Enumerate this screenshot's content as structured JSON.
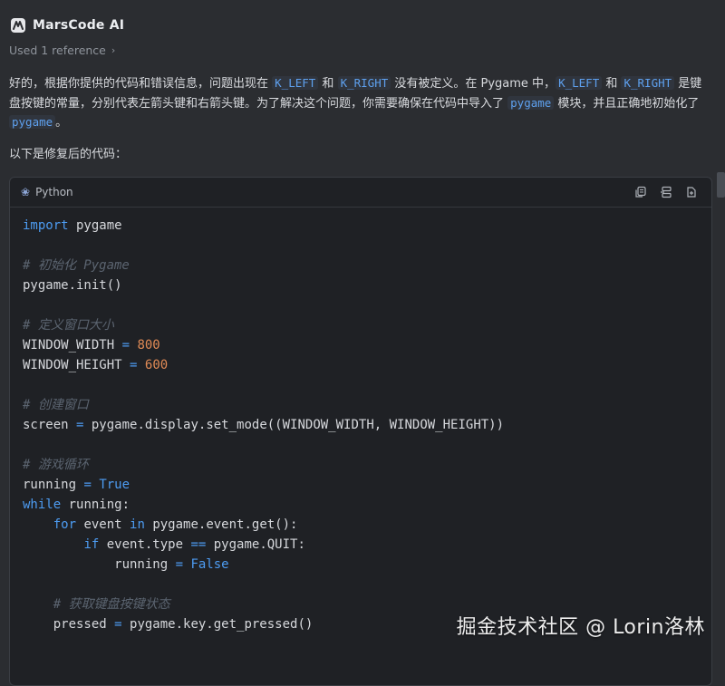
{
  "app": {
    "title": "MarsCode AI"
  },
  "reference": {
    "label": "Used 1 reference"
  },
  "message": {
    "p1_a": "好的，根据你提供的代码和错误信息，问题出现在 ",
    "tok_kleft": "K_LEFT",
    "p1_b": " 和 ",
    "tok_kright": "K_RIGHT",
    "p1_c": " 没有被定义。在 Pygame 中，",
    "tok_kleft2": "K_LEFT",
    "p1_d": " 和 ",
    "tok_kright2": "K_RIGHT",
    "p1_e": " 是键盘按键的常量，分别代表左箭头键和右箭头键。为了解决这个问题，你需要确保在代码中导入了 ",
    "tok_pygame": "pygame",
    "p1_f": " 模块，并且正确地初始化了 ",
    "tok_pygame2": "pygame",
    "p1_g": "。",
    "lead": "以下是修复后的代码："
  },
  "code": {
    "language": "Python",
    "lines": [
      [
        {
          "t": "import",
          "c": "kw"
        },
        {
          "t": " pygame"
        }
      ],
      [],
      [
        {
          "t": "# 初始化 Pygame",
          "c": "com"
        }
      ],
      [
        {
          "t": "pygame.init()"
        }
      ],
      [],
      [
        {
          "t": "# 定义窗口大小",
          "c": "com"
        }
      ],
      [
        {
          "t": "WINDOW_WIDTH "
        },
        {
          "t": "=",
          "c": "kw"
        },
        {
          "t": " "
        },
        {
          "t": "800",
          "c": "num"
        }
      ],
      [
        {
          "t": "WINDOW_HEIGHT "
        },
        {
          "t": "=",
          "c": "kw"
        },
        {
          "t": " "
        },
        {
          "t": "600",
          "c": "num"
        }
      ],
      [],
      [
        {
          "t": "# 创建窗口",
          "c": "com"
        }
      ],
      [
        {
          "t": "screen "
        },
        {
          "t": "=",
          "c": "kw"
        },
        {
          "t": " pygame.display.set_mode((WINDOW_WIDTH, WINDOW_HEIGHT))"
        }
      ],
      [],
      [
        {
          "t": "# 游戏循环",
          "c": "com"
        }
      ],
      [
        {
          "t": "running "
        },
        {
          "t": "=",
          "c": "kw"
        },
        {
          "t": " "
        },
        {
          "t": "True",
          "c": "kw"
        }
      ],
      [
        {
          "t": "while",
          "c": "kw"
        },
        {
          "t": " running:"
        }
      ],
      [
        {
          "t": "    "
        },
        {
          "t": "for",
          "c": "kw"
        },
        {
          "t": " event "
        },
        {
          "t": "in",
          "c": "kw"
        },
        {
          "t": " pygame.event.get():"
        }
      ],
      [
        {
          "t": "        "
        },
        {
          "t": "if",
          "c": "kw"
        },
        {
          "t": " event.type "
        },
        {
          "t": "==",
          "c": "kw"
        },
        {
          "t": " pygame.QUIT:"
        }
      ],
      [
        {
          "t": "            running "
        },
        {
          "t": "=",
          "c": "kw"
        },
        {
          "t": " "
        },
        {
          "t": "False",
          "c": "kw"
        }
      ],
      [],
      [
        {
          "t": "    "
        },
        {
          "t": "# 获取键盘按键状态",
          "c": "com"
        }
      ],
      [
        {
          "t": "    pressed "
        },
        {
          "t": "=",
          "c": "kw"
        },
        {
          "t": " pygame.key.get_pressed()"
        }
      ]
    ]
  },
  "watermark": {
    "text": "掘金技术社区 @ Lorin洛林"
  },
  "colors": {
    "background": "#2b2d31",
    "code_bg": "#1f2125",
    "keyword": "#4d9cf2",
    "number": "#e08a55",
    "comment": "#5b6470",
    "token": "#5ea0ee"
  }
}
